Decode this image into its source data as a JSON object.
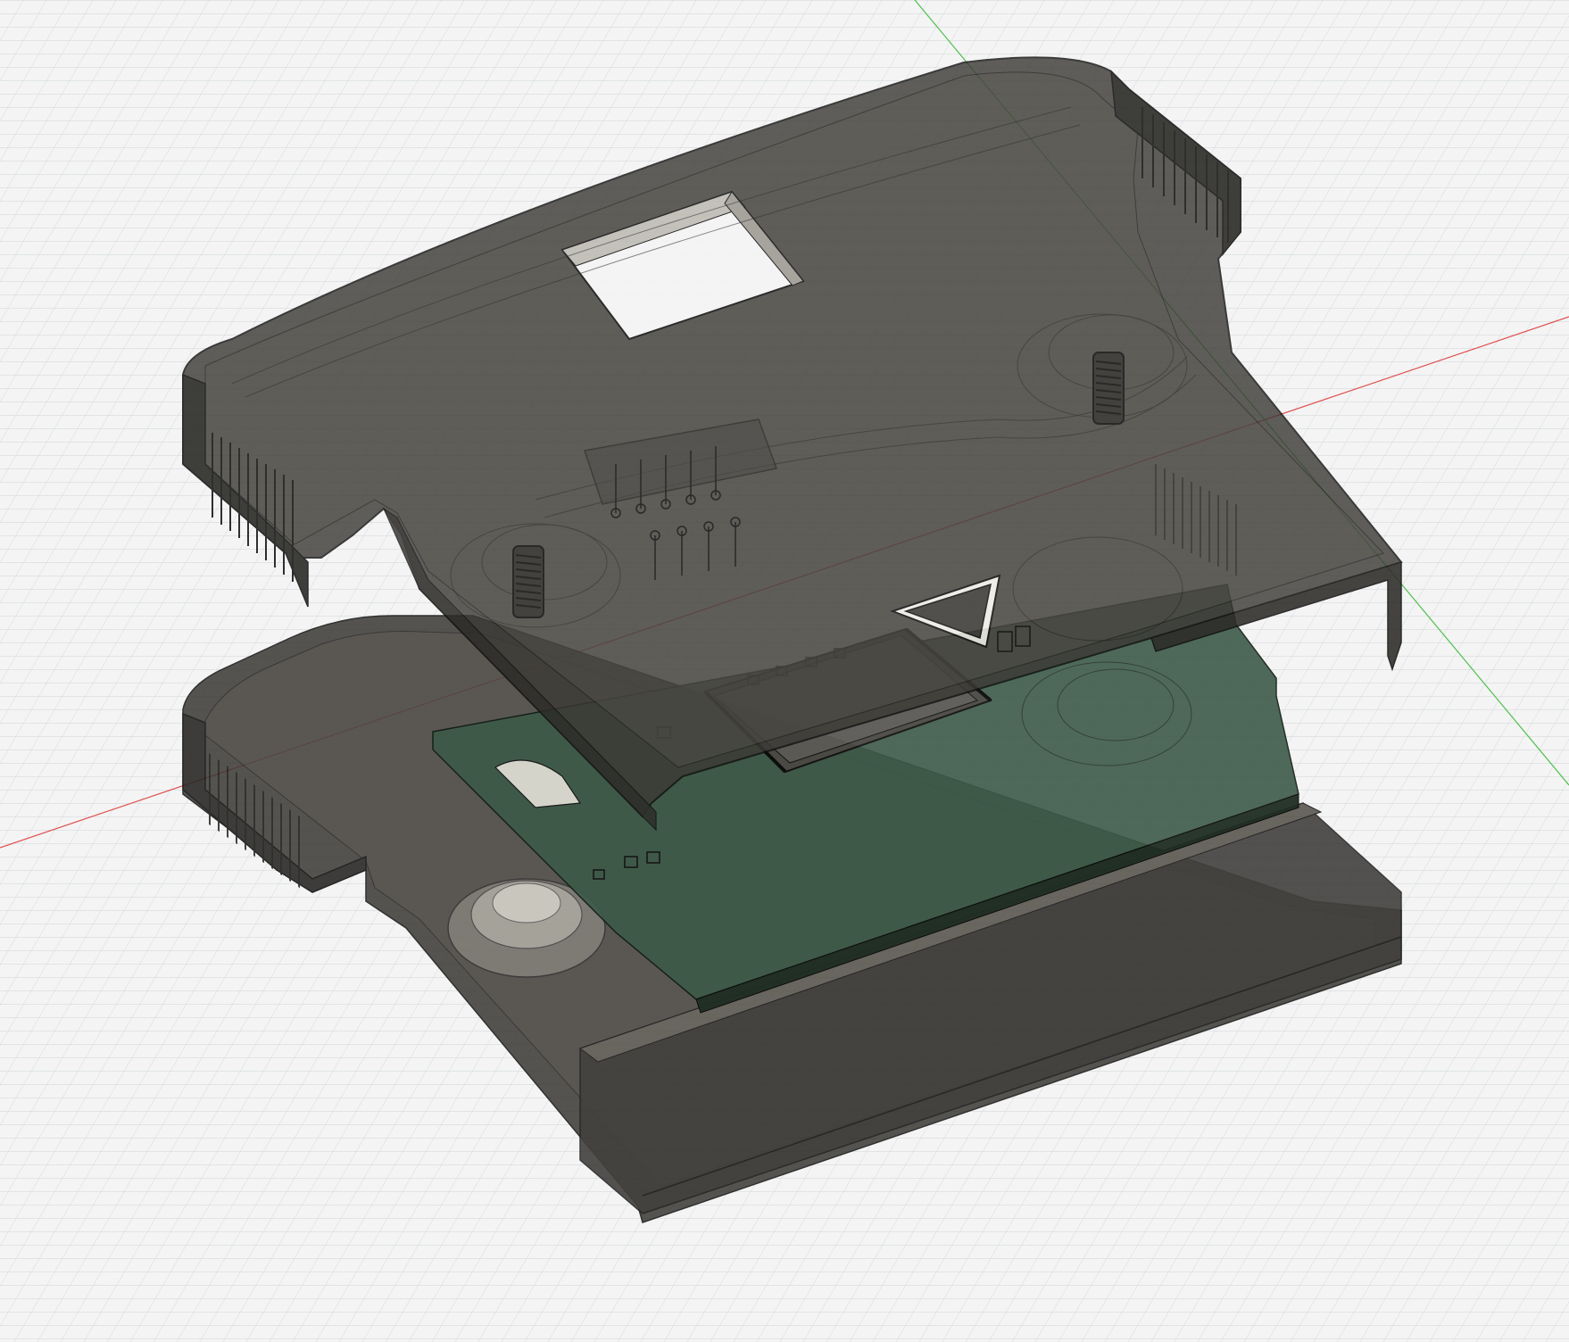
{
  "viewport": {
    "view": "cad-3d-viewport",
    "background_color": "#f4f4f4",
    "grid_color": "#d2d6db",
    "x_axis_color": "#e05050",
    "y_axis_color": "#50c050",
    "grid_visible": true
  },
  "model": {
    "components": [
      {
        "name": "top-shell",
        "color": "#3c3a36",
        "opacity": 0.88
      },
      {
        "name": "pcb",
        "color": "#3d5a48",
        "opacity": 0.95
      },
      {
        "name": "bottom-shell",
        "color": "#3a3834",
        "opacity": 0.9
      }
    ],
    "features": [
      "rectangular-cutout",
      "standoff-springs",
      "side-ribs",
      "pin-headers",
      "triangle-indicator",
      "chip-connector",
      "round-boss"
    ]
  }
}
